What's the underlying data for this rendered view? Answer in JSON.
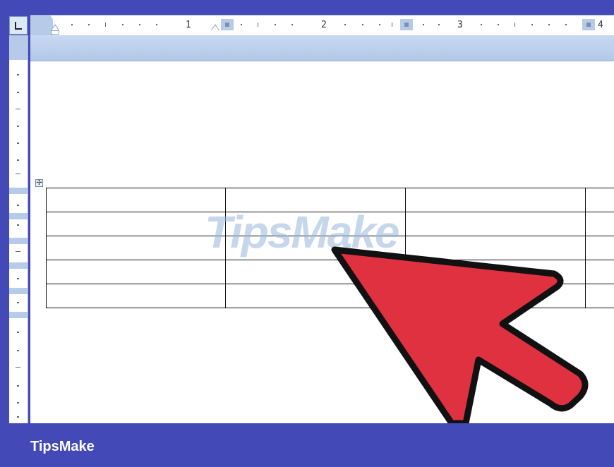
{
  "ruler": {
    "numbers": [
      "1",
      "2",
      "3",
      "4"
    ]
  },
  "watermark": {
    "text": "TipsMake"
  },
  "footer": {
    "brand": "TipsMake"
  },
  "table": {
    "rows": 5,
    "columns": 4
  },
  "colors": {
    "frame": "#4349b7",
    "arrow_fill": "#e03141",
    "arrow_stroke": "#111111",
    "ruler_shade": "#b7cbe8"
  },
  "icons": [
    "tab-selector-icon",
    "table-move-handle-icon",
    "pointer-arrow-icon"
  ]
}
